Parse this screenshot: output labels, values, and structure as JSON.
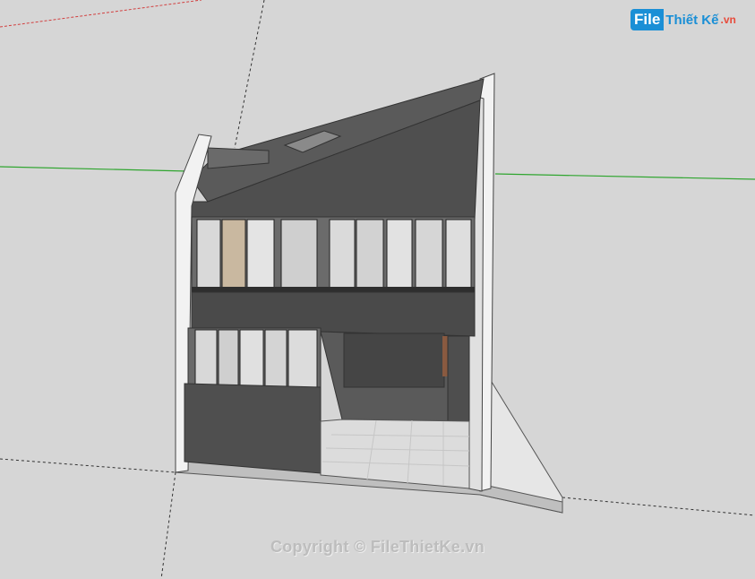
{
  "watermark": {
    "logo_file": "File",
    "logo_brand": "Thiết Kế",
    "logo_tld": ".vn",
    "copyright": "Copyright © FileThietKe.vn"
  },
  "colors": {
    "background": "#d6d6d6",
    "wall_dark": "#4f4f4f",
    "roof": "#5a5a5a",
    "white_frame": "#f4f4f4",
    "green_axis": "#2fa52f",
    "red_axis": "#d24040",
    "floor": "#dcdcdc"
  }
}
